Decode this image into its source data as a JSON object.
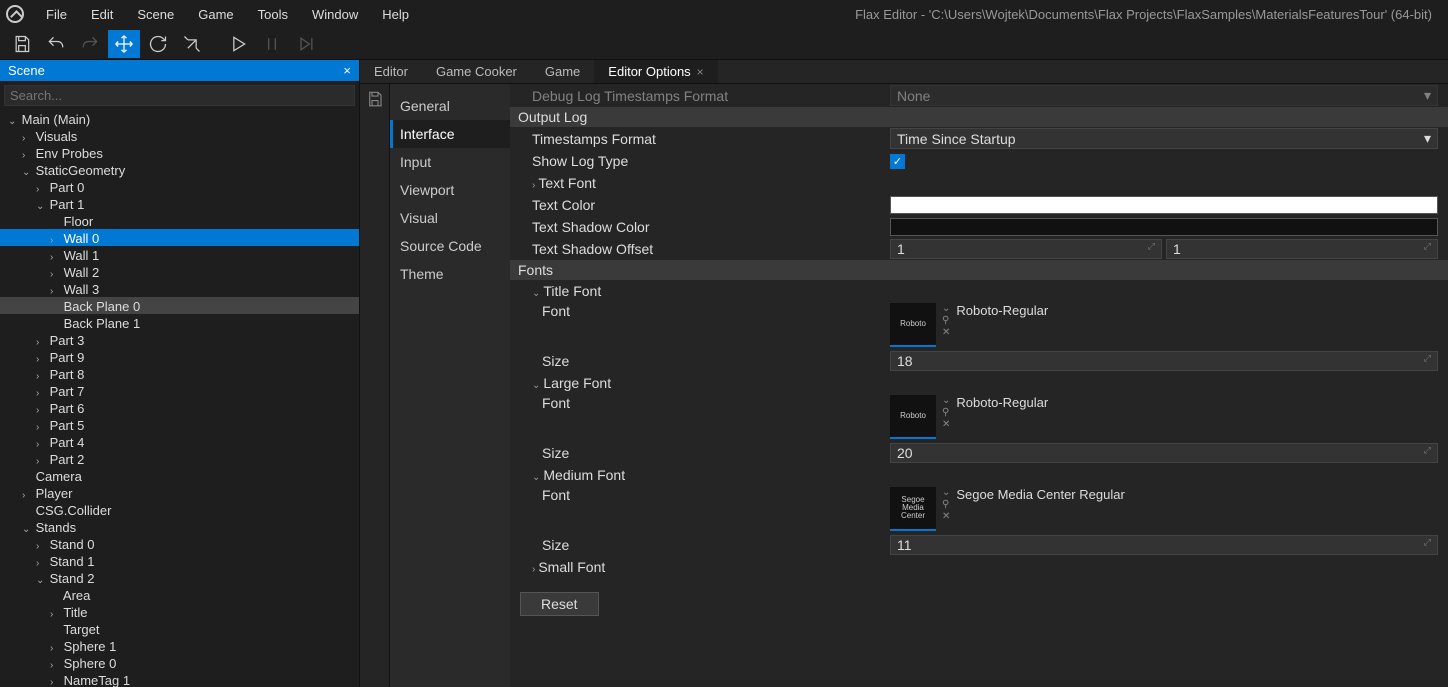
{
  "app_title": "Flax Editor - 'C:\\Users\\Wojtek\\Documents\\Flax Projects\\FlaxSamples\\MaterialsFeaturesTour' (64-bit)",
  "menus": [
    "File",
    "Edit",
    "Scene",
    "Game",
    "Tools",
    "Window",
    "Help"
  ],
  "scene_panel": {
    "title": "Scene",
    "search_placeholder": "Search...",
    "tree": [
      {
        "label": "Main (Main)",
        "depth": 0,
        "arrow": "v"
      },
      {
        "label": "Visuals",
        "depth": 1,
        "arrow": ">"
      },
      {
        "label": "Env Probes",
        "depth": 1,
        "arrow": ">"
      },
      {
        "label": "StaticGeometry",
        "depth": 1,
        "arrow": "v"
      },
      {
        "label": "Part 0",
        "depth": 2,
        "arrow": ">"
      },
      {
        "label": "Part 1",
        "depth": 2,
        "arrow": "v"
      },
      {
        "label": "Floor",
        "depth": 3,
        "arrow": ""
      },
      {
        "label": "Wall 0",
        "depth": 3,
        "arrow": ">",
        "selected": true
      },
      {
        "label": "Wall 1",
        "depth": 3,
        "arrow": ">"
      },
      {
        "label": "Wall 2",
        "depth": 3,
        "arrow": ">"
      },
      {
        "label": "Wall 3",
        "depth": 3,
        "arrow": ">"
      },
      {
        "label": "Back Plane 0",
        "depth": 3,
        "arrow": "",
        "highlighted": true
      },
      {
        "label": "Back Plane 1",
        "depth": 3,
        "arrow": ""
      },
      {
        "label": "Part 3",
        "depth": 2,
        "arrow": ">"
      },
      {
        "label": "Part 9",
        "depth": 2,
        "arrow": ">"
      },
      {
        "label": "Part 8",
        "depth": 2,
        "arrow": ">"
      },
      {
        "label": "Part 7",
        "depth": 2,
        "arrow": ">"
      },
      {
        "label": "Part 6",
        "depth": 2,
        "arrow": ">"
      },
      {
        "label": "Part 5",
        "depth": 2,
        "arrow": ">"
      },
      {
        "label": "Part 4",
        "depth": 2,
        "arrow": ">"
      },
      {
        "label": "Part 2",
        "depth": 2,
        "arrow": ">"
      },
      {
        "label": "Camera",
        "depth": 1,
        "arrow": ""
      },
      {
        "label": "Player",
        "depth": 1,
        "arrow": ">"
      },
      {
        "label": "CSG.Collider",
        "depth": 1,
        "arrow": ""
      },
      {
        "label": "Stands",
        "depth": 1,
        "arrow": "v"
      },
      {
        "label": "Stand 0",
        "depth": 2,
        "arrow": ">"
      },
      {
        "label": "Stand 1",
        "depth": 2,
        "arrow": ">"
      },
      {
        "label": "Stand 2",
        "depth": 2,
        "arrow": "v"
      },
      {
        "label": "Area",
        "depth": 3,
        "arrow": ""
      },
      {
        "label": "Title",
        "depth": 3,
        "arrow": ">"
      },
      {
        "label": "Target",
        "depth": 3,
        "arrow": ""
      },
      {
        "label": "Sphere 1",
        "depth": 3,
        "arrow": ">"
      },
      {
        "label": "Sphere 0",
        "depth": 3,
        "arrow": ">"
      },
      {
        "label": "NameTag 1",
        "depth": 3,
        "arrow": ">"
      }
    ]
  },
  "tabs": [
    {
      "label": "Editor",
      "active": false
    },
    {
      "label": "Game Cooker",
      "active": false
    },
    {
      "label": "Game",
      "active": false
    },
    {
      "label": "Editor Options",
      "active": true,
      "closable": true
    }
  ],
  "categories": [
    "General",
    "Interface",
    "Input",
    "Viewport",
    "Visual",
    "Source Code",
    "Theme"
  ],
  "active_category": "Interface",
  "props": {
    "debug_log_ts": {
      "label": "Debug Log Timestamps Format",
      "value": "None"
    },
    "output_log_header": "Output Log",
    "ts_format": {
      "label": "Timestamps Format",
      "value": "Time Since Startup"
    },
    "show_log_type": {
      "label": "Show Log Type"
    },
    "text_font": {
      "label": "Text Font"
    },
    "text_color": {
      "label": "Text Color",
      "value": "#ffffff"
    },
    "text_shadow_color": {
      "label": "Text Shadow Color",
      "value": "#111111"
    },
    "text_shadow_offset": {
      "label": "Text Shadow Offset",
      "x": "1",
      "y": "1"
    },
    "fonts_header": "Fonts",
    "title_font": {
      "label": "Title Font",
      "font_label": "Font",
      "font_name": "Roboto-Regular",
      "thumb": "Roboto",
      "size_label": "Size",
      "size": "18"
    },
    "large_font": {
      "label": "Large Font",
      "font_label": "Font",
      "font_name": "Roboto-Regular",
      "thumb": "Roboto",
      "size_label": "Size",
      "size": "20"
    },
    "medium_font": {
      "label": "Medium Font",
      "font_label": "Font",
      "font_name": "Segoe Media Center Regular",
      "thumb": "Segoe Media Center",
      "size_label": "Size",
      "size": "11"
    },
    "small_font": {
      "label": "Small Font"
    },
    "reset": "Reset"
  }
}
